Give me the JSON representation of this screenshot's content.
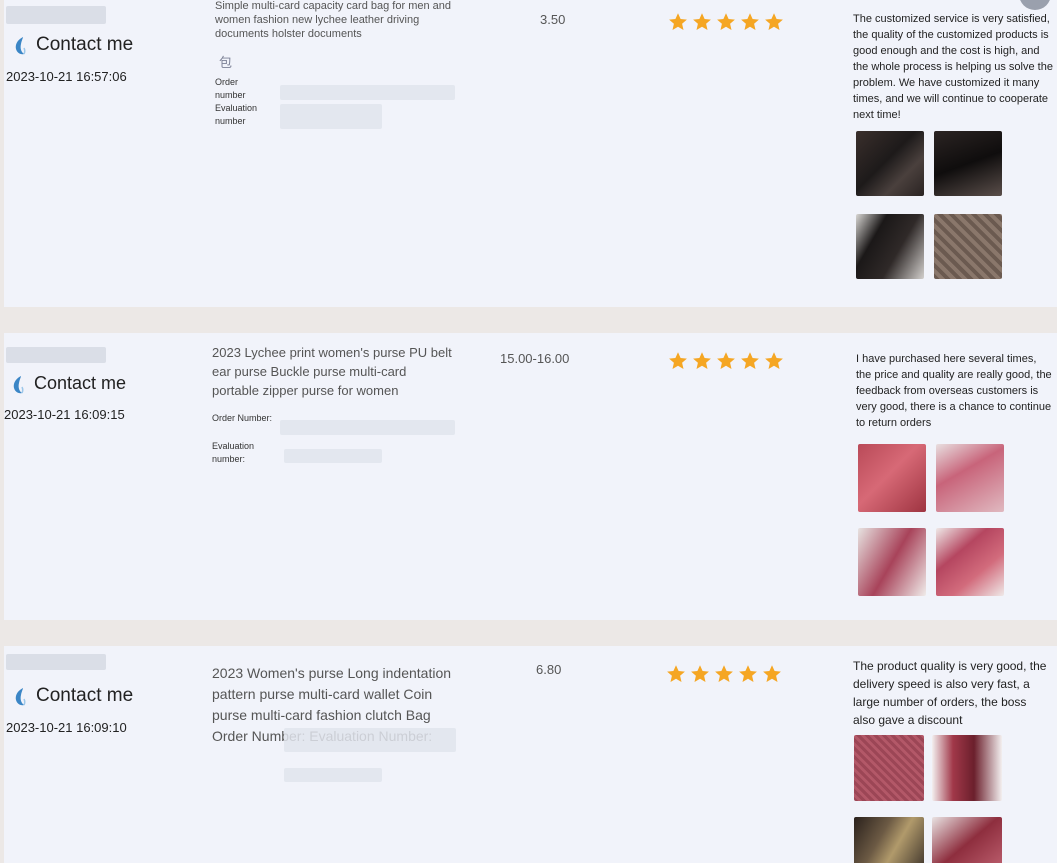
{
  "rows": [
    {
      "contact_label": "Contact me",
      "date": "2023-10-21 16:57:06",
      "product_title": "Simple multi-card capacity card bag for men and women fashion new lychee leather driving documents holster documents",
      "bag_glyph": "包",
      "order_label": "Order number",
      "evaluation_label": "Evaluation number",
      "price": "3.50",
      "rating": 5,
      "review": "The customized service is very satisfied, the quality of the customized products is good enough and the cost is high, and the whole process is helping us solve the problem. We have customized it many times, and we will continue to cooperate next time!"
    },
    {
      "contact_label": "Contact me",
      "date": "2023-10-21 16:09:15",
      "product_title": "2023 Lychee print women's purse PU belt ear purse Buckle purse multi-card portable zipper purse for women",
      "order_label": "Order Number:",
      "evaluation_label": "Evaluation number:",
      "price": "15.00-16.00",
      "rating": 5,
      "review": "I have purchased here several times, the price and quality are really good, the feedback from overseas customers is very good, there is a chance to continue to return orders"
    },
    {
      "contact_label": "Contact me",
      "date": "2023-10-21 16:09:10",
      "product_title": "2023 Women's purse Long indentation pattern purse multi-card wallet Coin purse multi-card fashion clutch Bag Order Number: Evaluation Number:",
      "price": "6.80",
      "rating": 5,
      "review": "The product quality is very good, the delivery speed is also very fast, a large number of orders, the boss also gave a discount"
    }
  ],
  "colors": {
    "star": "#f5a623",
    "contact_icon": "#3b86c6",
    "row_background": "#f1f3fa",
    "separator": "#ece8e6"
  }
}
